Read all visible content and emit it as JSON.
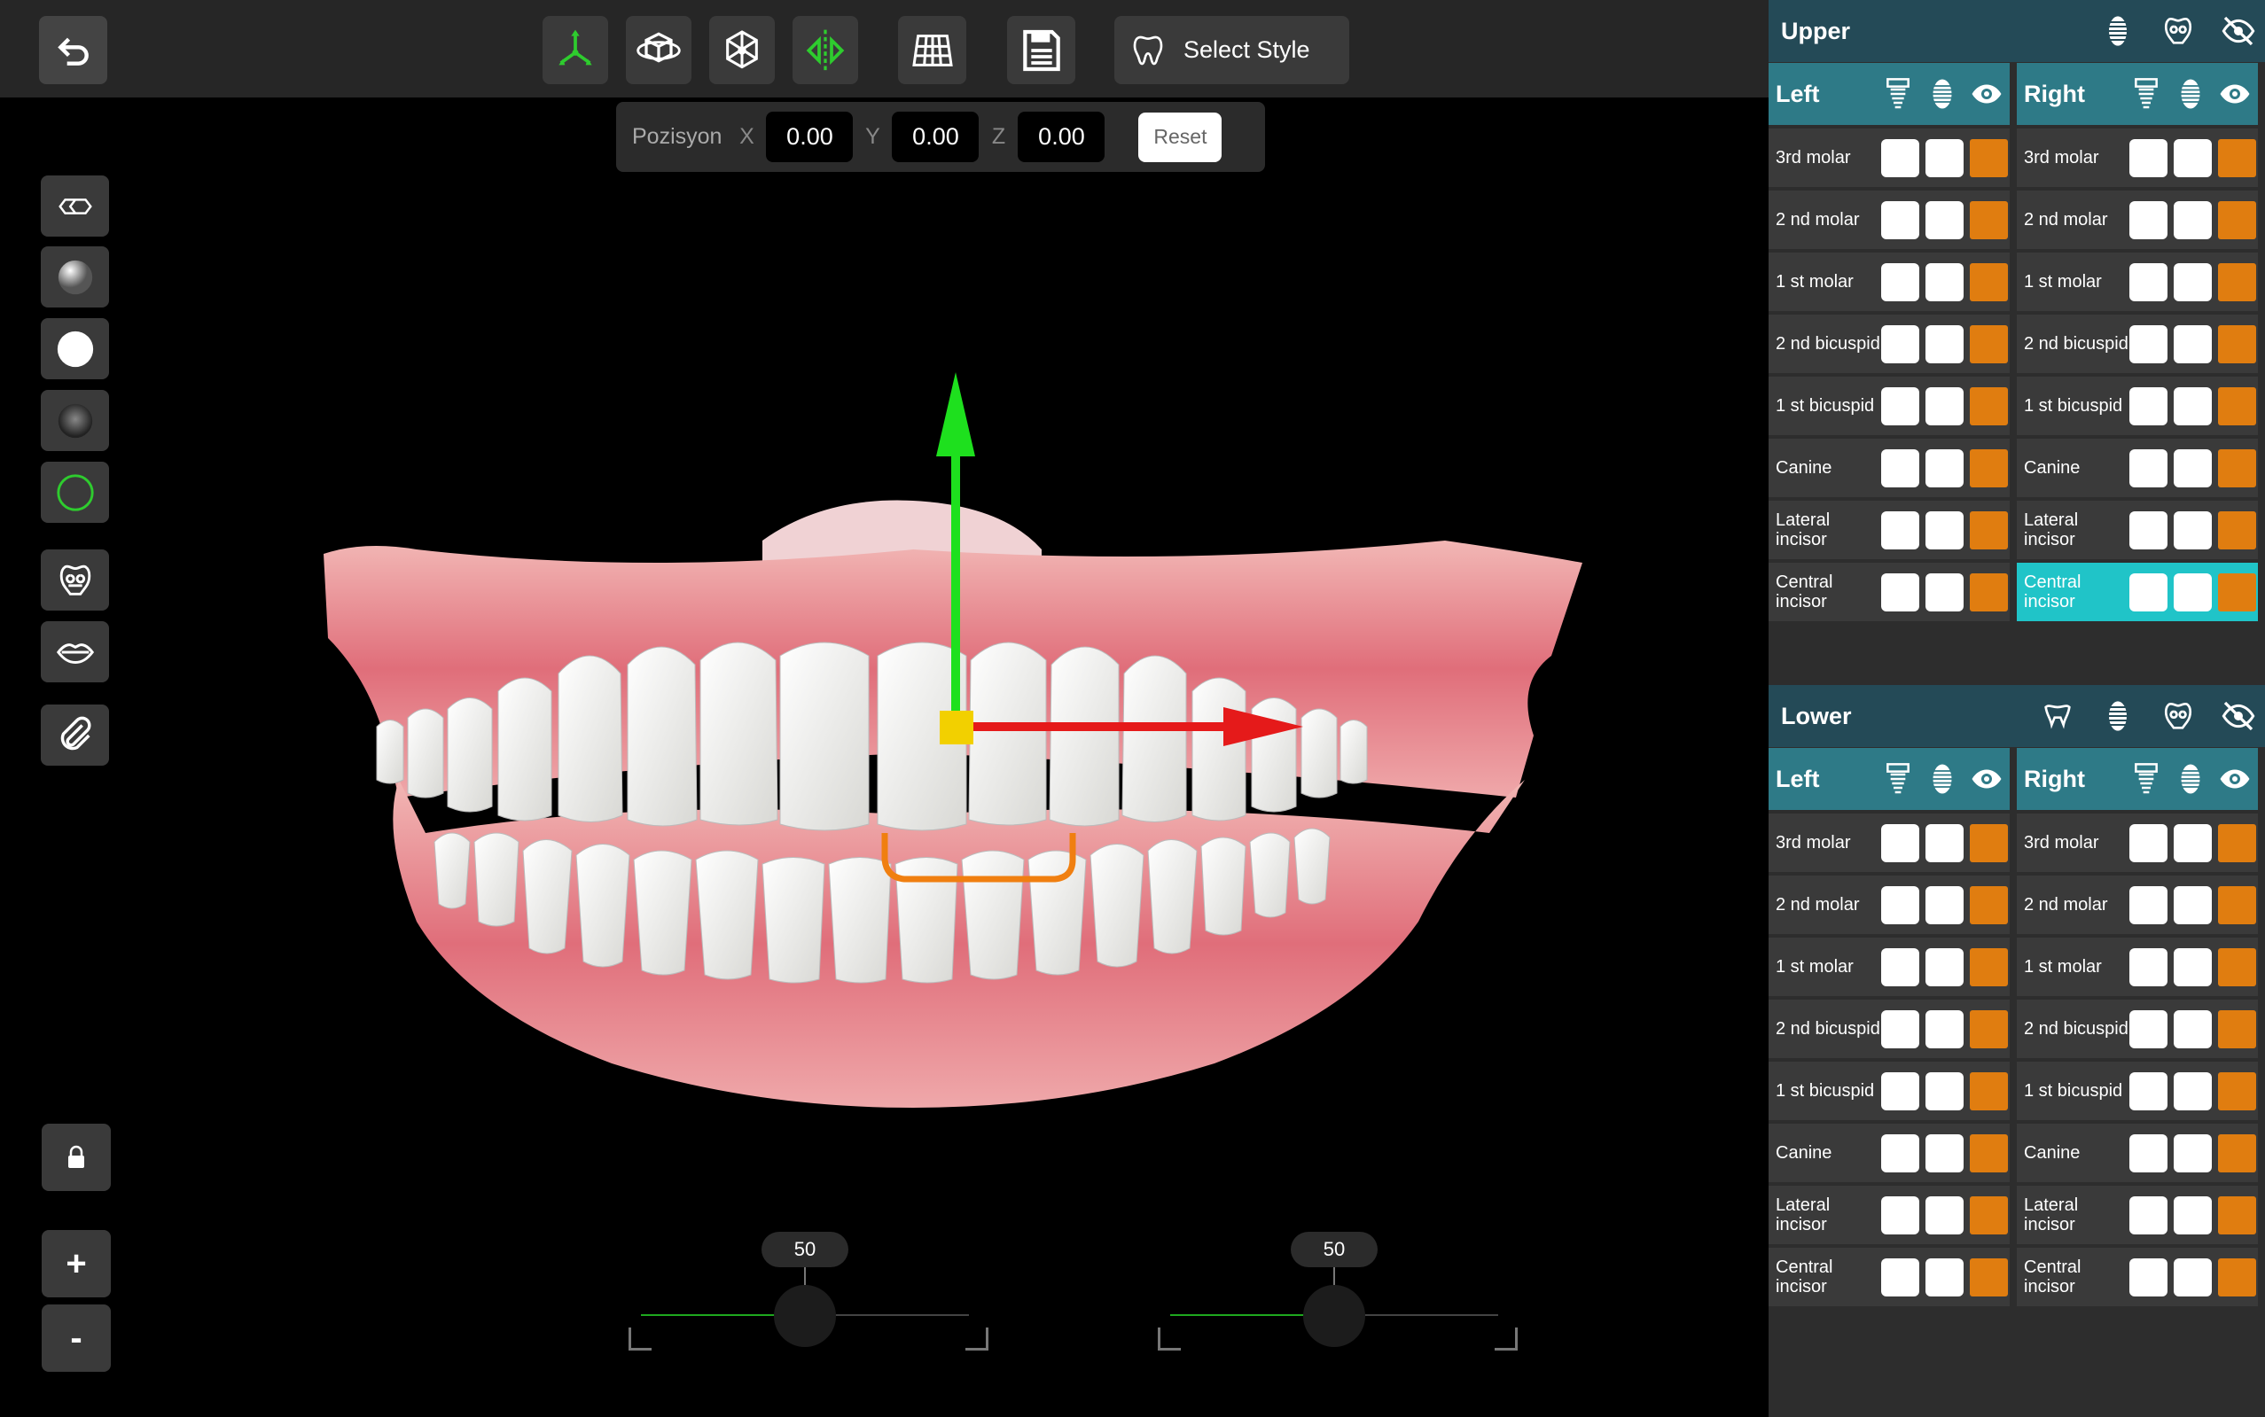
{
  "toolbar": {
    "select_style": "Select Style",
    "icons": [
      "move-gizmo-icon",
      "rotate-cube-icon",
      "scale-mesh-icon",
      "mirror-icon",
      "grid-icon",
      "save-icon",
      "tooth-icon"
    ]
  },
  "position": {
    "label": "Pozisyon",
    "x_label": "X",
    "x": "0.00",
    "y_label": "Y",
    "y": "0.00",
    "z_label": "Z",
    "z": "0.00",
    "reset": "Reset"
  },
  "sliders": [
    {
      "value": "50",
      "fraction": 0.5
    },
    {
      "value": "50",
      "fraction": 0.5
    }
  ],
  "zoom": {
    "plus": "+",
    "minus": "-"
  },
  "upper": {
    "title": "Upper",
    "left_label": "Left",
    "right_label": "Right",
    "teeth": [
      "3rd molar",
      "2 nd  molar",
      "1 st molar",
      "2 nd bicuspid",
      "1 st bicuspid",
      "Canine",
      "Lateral incisor",
      "Central incisor"
    ],
    "selected_right": "Central incisor"
  },
  "lower": {
    "title": "Lower",
    "left_label": "Left",
    "right_label": "Right",
    "teeth": [
      "3rd molar",
      "2 nd  molar",
      "1 st molar",
      "2 nd bicuspid",
      "1 st bicuspid",
      "Canine",
      "Lateral incisor",
      "Central incisor"
    ]
  },
  "colors": {
    "accent_green": "#2ecc2e",
    "header_teal": "#2e7a87",
    "selected_cyan": "#20c4c8",
    "orange": "#e07d10"
  }
}
